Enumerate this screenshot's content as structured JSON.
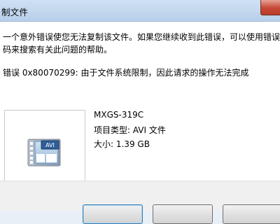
{
  "window": {
    "title": "制文件"
  },
  "message": {
    "lines": [
      "一个意外错误使您无法复制该文件。如果您继续收到此错误，可以使用错误代",
      "码来搜索有关此问题的帮助。"
    ],
    "error": "错误 0x80070299: 由于文件系统限制，因此请求的操作无法完成"
  },
  "file": {
    "name": "MXGS-319C",
    "type": "项目类型: AVI 文件",
    "size": "大小: 1.39 GB",
    "icon_label": "AVI"
  },
  "buttons": {
    "left_label": "",
    "middle_label": "",
    "right_label": ""
  }
}
